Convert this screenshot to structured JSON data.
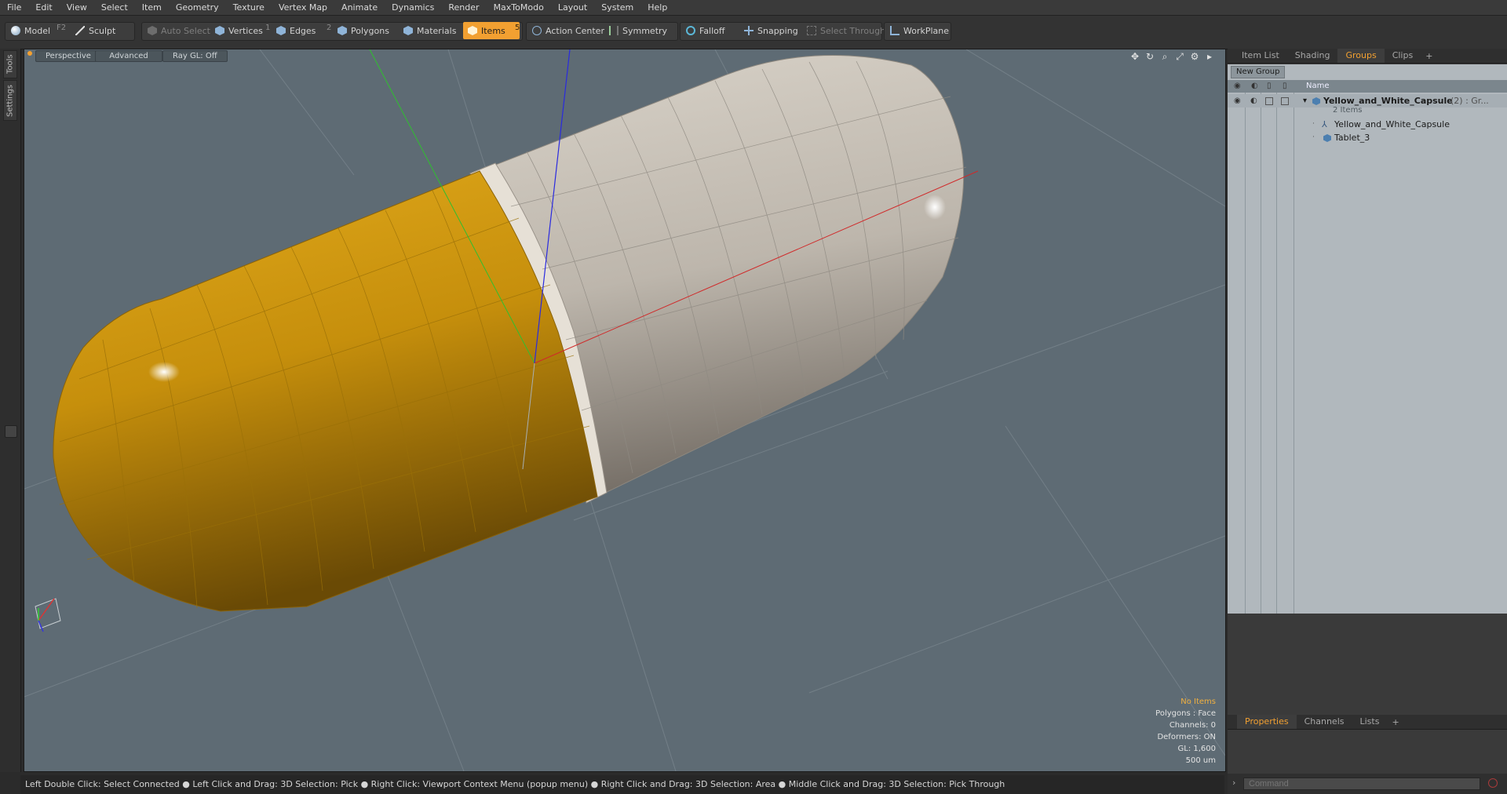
{
  "menu": [
    "File",
    "Edit",
    "View",
    "Select",
    "Item",
    "Geometry",
    "Texture",
    "Vertex Map",
    "Animate",
    "Dynamics",
    "Render",
    "MaxToModo",
    "Layout",
    "System",
    "Help"
  ],
  "toolbar": {
    "model": "Model",
    "model_key": "F2",
    "sculpt": "Sculpt",
    "auto_select": "Auto Select",
    "vertices": "Vertices",
    "vertices_count": "1",
    "edges": "Edges",
    "edges_count": "2",
    "polygons": "Polygons",
    "materials": "Materials",
    "items": "Items",
    "items_count": "5",
    "action_center": "Action Center",
    "symmetry": "Symmetry",
    "falloff": "Falloff",
    "snapping": "Snapping",
    "select_through": "Select Through",
    "workplane": "WorkPlane"
  },
  "left_tabs": [
    "Tools",
    "Settings"
  ],
  "viewport": {
    "view_mode": "Perspective",
    "shading": "Advanced",
    "raygl": "Ray GL: Off",
    "info": {
      "selection": "No Items",
      "polygons": "Polygons : Face",
      "channels": "Channels: 0",
      "deformers": "Deformers: ON",
      "gl": "GL: 1,600",
      "scale": "500 um"
    }
  },
  "status": "Left Double Click: Select Connected ● Left Click and Drag: 3D Selection: Pick ● Right Click: Viewport Context Menu (popup menu) ● Right Click and Drag: 3D Selection: Area ● Middle Click and Drag: 3D Selection: Pick Through",
  "panel": {
    "tabs": [
      "Item List",
      "Shading",
      "Groups",
      "Clips"
    ],
    "active_tab": "Groups",
    "new_group": "New Group",
    "col_name": "Name",
    "group_name": "Yellow_and_White_Capsule",
    "group_suffix": "(2) : Gr...",
    "group_count": "2 Items",
    "child1": "Yellow_and_White_Capsule",
    "child2": "Tablet_3"
  },
  "bottom_tabs": [
    "Properties",
    "Channels",
    "Lists"
  ],
  "command_placeholder": "Command",
  "colors": {
    "accent": "#f2a031",
    "viewport_bg": "#5e6b74",
    "capsule_yellow": "#d39a12",
    "capsule_white": "#c9c2b8"
  }
}
